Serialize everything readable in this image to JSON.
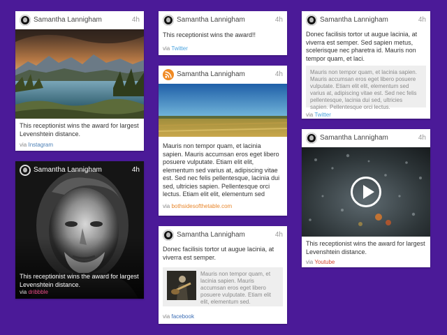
{
  "author": "Samantha Lannigham",
  "time": "4h",
  "cards": [
    {
      "text": "This receptionist wins the award for largest Levenshtein distance.",
      "via": "via",
      "source": "Instagram",
      "source_color": "#4a7fb5"
    },
    {
      "text": "This receptionist wins the award for largest Levenshtein distance.",
      "via": "via",
      "source": "dribbble",
      "source_color": "#ea4c89"
    },
    {
      "text": "This receptionist wins the award!!",
      "via": "via",
      "source": "Twitter",
      "source_color": "#4aa3df"
    },
    {
      "text": "Mauris non tempor quam, et lacinia sapien. Mauris accumsan eros eget libero posuere vulputate. Etiam elit elit, elementum sed varius at, adipiscing vitae est. Sed nec felis pellentesque, lacinia dui sed, ultricies sapien. Pellentesque orci lectus. Etiam elit elit, elementum sed varius at, adipiscing vitae est. Gros eget libero posuere vul...",
      "via": "via",
      "source": "bothsidesofthetable.com",
      "source_color": "#e8862b"
    },
    {
      "text": "Donec facilisis tortor ut augue lacinia, at viverra est semper.",
      "quote": "Mauris non tempor quam, et lacinia sapien. Mauris accumsan eros eget libero posuere vulputate. Etiam elit elit, elementum sed.",
      "via": "via",
      "source": "facebook",
      "source_color": "#3b6db5"
    },
    {
      "text": "Donec facilisis tortor ut augue lacinia, at viverra est semper. Sed sapien metus, scelerisque nec pharetra id. Mauris non tempor quam, et laci.",
      "quote": "Mauris non tempor quam, et lacinia sapien. Mauris accumsan eros eget libero posuere vulputate. Etiam elit elit, elementum sed varius at, adipiscing vitae est. Sed nec felis pellentesque, lacinia dui sed, ultricies sapien. Pellentesque orci lectus.",
      "via": "via",
      "source": "Twitter",
      "source_color": "#4aa3df"
    },
    {
      "text": "This receptionist wins the award for largest Levenshtein distance.",
      "via": "via",
      "source": "Youtube",
      "source_color": "#d4472f"
    }
  ],
  "icons": {
    "feed": "rss-icon",
    "play": "play-icon",
    "avatar": "avatar-icon"
  }
}
